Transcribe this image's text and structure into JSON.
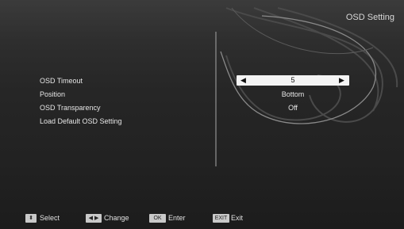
{
  "title": "OSD Setting",
  "menu": {
    "items": [
      {
        "label": "OSD Timeout",
        "value": "5"
      },
      {
        "label": "Position",
        "value": "Bottom"
      },
      {
        "label": "OSD Transparency",
        "value": "Off"
      },
      {
        "label": "Load Default OSD Setting",
        "value": ""
      }
    ],
    "selected_index": 0
  },
  "footer": {
    "select": {
      "key": "⬍",
      "label": "Select"
    },
    "change": {
      "key": "◀ ▶",
      "label": "Change"
    },
    "enter": {
      "key": "OK",
      "label": "Enter"
    },
    "exit": {
      "key": "EXIT",
      "label": "Exit"
    }
  }
}
